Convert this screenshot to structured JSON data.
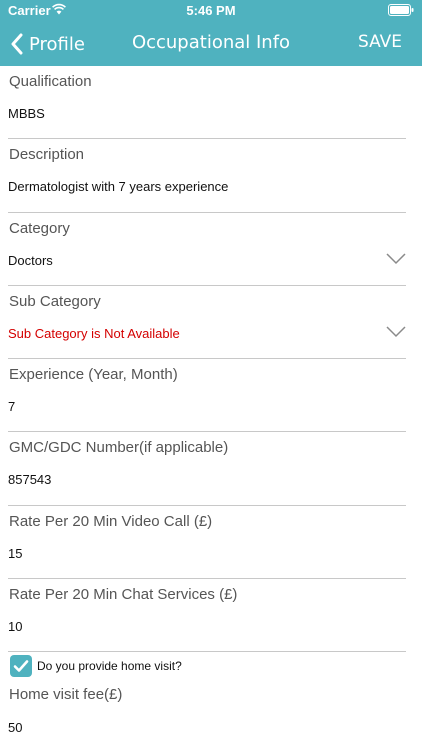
{
  "status_bar": {
    "carrier": "Carrier",
    "time": "5:46 PM",
    "wifi_icon": "wifi-icon",
    "battery_icon": "battery-icon"
  },
  "navbar": {
    "back_label": "Profile",
    "title": "Occupational Info",
    "save_label": "SAVE",
    "color": "#4fb2bf"
  },
  "fields": {
    "qualification": {
      "label": "Qualification",
      "value": "MBBS"
    },
    "description": {
      "label": "Description",
      "value": "Dermatologist with 7 years experience"
    },
    "category": {
      "label": "Category",
      "value": "Doctors"
    },
    "sub_category": {
      "label": "Sub Category",
      "value": "Sub Category is Not Available",
      "value_color": "#d40000"
    },
    "experience": {
      "label": "Experience (Year, Month)",
      "value": "7"
    },
    "gmc_gdc": {
      "label": "GMC/GDC Number(if applicable)",
      "value": "857543"
    },
    "rate_video": {
      "label": "Rate Per 20 Min Video Call (£)",
      "value": "15"
    },
    "rate_chat": {
      "label": "Rate Per 20 Min Chat Services (£)",
      "value": "10"
    },
    "home_visit_fee": {
      "label": "Home visit fee(£)",
      "value": "50"
    }
  },
  "home_visit": {
    "label": "Do you provide home visit?",
    "checked": true
  }
}
